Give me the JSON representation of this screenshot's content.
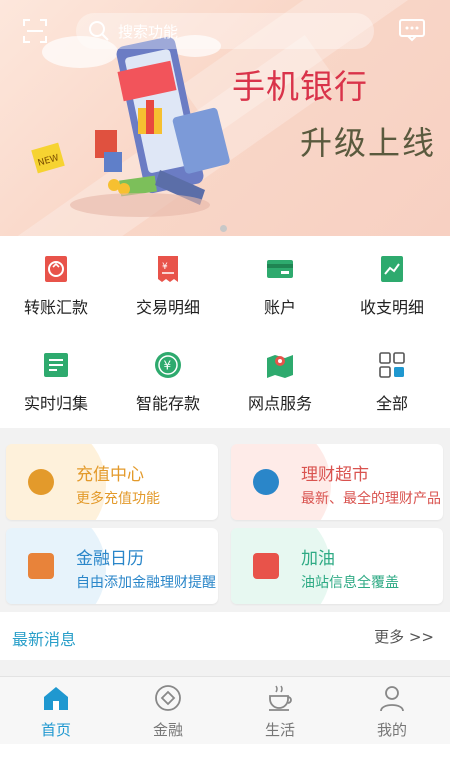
{
  "topbar": {
    "search_placeholder": "搜索功能"
  },
  "banner": {
    "title": "手机银行",
    "subtitle": "升级上线",
    "illustration_badge": "NEW"
  },
  "quick_menu": [
    {
      "label": "转账汇款",
      "icon": "transfer-icon"
    },
    {
      "label": "交易明细",
      "icon": "receipt-icon"
    },
    {
      "label": "账户",
      "icon": "card-icon"
    },
    {
      "label": "收支明细",
      "icon": "chart-icon"
    },
    {
      "label": "实时归集",
      "icon": "collect-icon"
    },
    {
      "label": "智能存款",
      "icon": "yen-coin-icon"
    },
    {
      "label": "网点服务",
      "icon": "map-icon"
    },
    {
      "label": "全部",
      "icon": "grid-icon"
    }
  ],
  "cards": [
    {
      "title": "充值中心",
      "subtitle": "更多充值功能",
      "color": "#e39a2b",
      "blob": "#fde0b0"
    },
    {
      "title": "理财超市",
      "subtitle": "最新、最全的理财产品",
      "color": "#d9534f",
      "blob": "#fcd2cd"
    },
    {
      "title": "金融日历",
      "subtitle": "自由添加金融理财提醒",
      "color": "#2a86c9",
      "blob": "#c9e4f6"
    },
    {
      "title": "加油",
      "subtitle": "油站信息全覆盖",
      "color": "#2eaa84",
      "blob": "#c9efe1"
    }
  ],
  "news": {
    "title": "最新消息",
    "more": "更多 >>"
  },
  "tabs": [
    {
      "label": "首页",
      "active": true
    },
    {
      "label": "金融",
      "active": false
    },
    {
      "label": "生活",
      "active": false
    },
    {
      "label": "我的",
      "active": false
    }
  ],
  "colors": {
    "accent": "#1f98d0",
    "banner_title": "#d9334a"
  }
}
